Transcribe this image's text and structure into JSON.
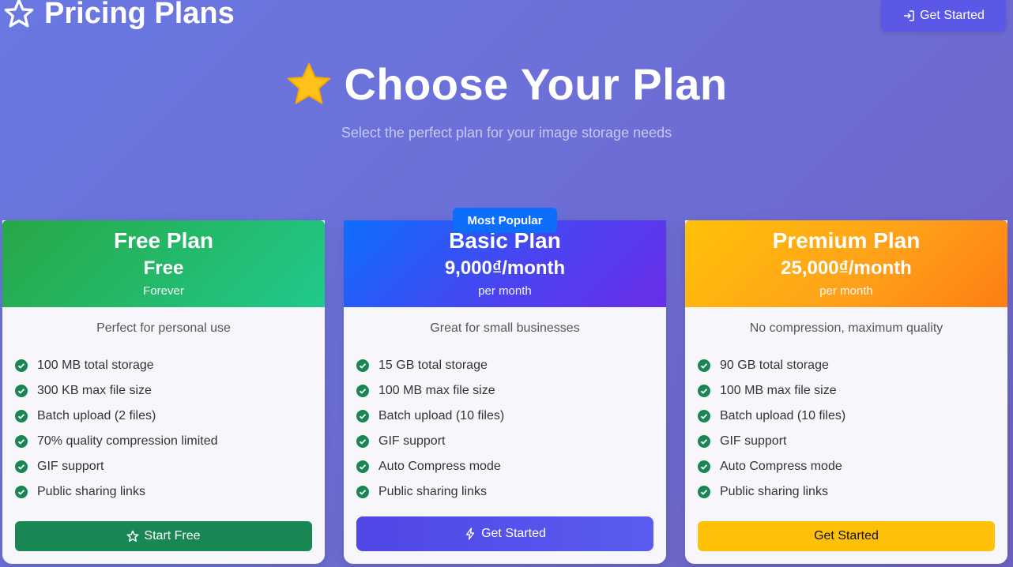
{
  "header": {
    "title": "Pricing Plans",
    "nav_button_label": "Get Started"
  },
  "hero": {
    "title": "Choose Your Plan",
    "subtitle": "Select the perfect plan for your image storage needs"
  },
  "plans": [
    {
      "name": "Free Plan",
      "price": "Free",
      "period": "Forever",
      "description": "Perfect for personal use",
      "features": [
        "100 MB total storage",
        "300 KB max file size",
        "Batch upload (2 files)",
        "70% quality compression limited",
        "GIF support",
        "Public sharing links"
      ],
      "cta": "Start Free",
      "cta_icon": "star-icon"
    },
    {
      "name": "Basic Plan",
      "badge": "Most Popular",
      "price": "9,000₫/month",
      "period": "per month",
      "description": "Great for small businesses",
      "features": [
        "15 GB total storage",
        "100 MB max file size",
        "Batch upload (10 files)",
        "GIF support",
        "Auto Compress mode",
        "Public sharing links"
      ],
      "cta": "Get Started",
      "cta_icon": "lightning-icon"
    },
    {
      "name": "Premium Plan",
      "price": "25,000₫/month",
      "period": "per month",
      "description": "No compression, maximum quality",
      "features": [
        "90 GB total storage",
        "100 MB max file size",
        "Batch upload (10 files)",
        "GIF support",
        "Auto Compress mode",
        "Public sharing links"
      ],
      "cta": "Get Started"
    }
  ],
  "colors": {
    "background": "#6c6fd6",
    "free_accent": "#198754",
    "basic_accent": "#4f46e5",
    "premium_accent": "#ffc107",
    "check": "#198754",
    "badge": "#0d6efd"
  }
}
